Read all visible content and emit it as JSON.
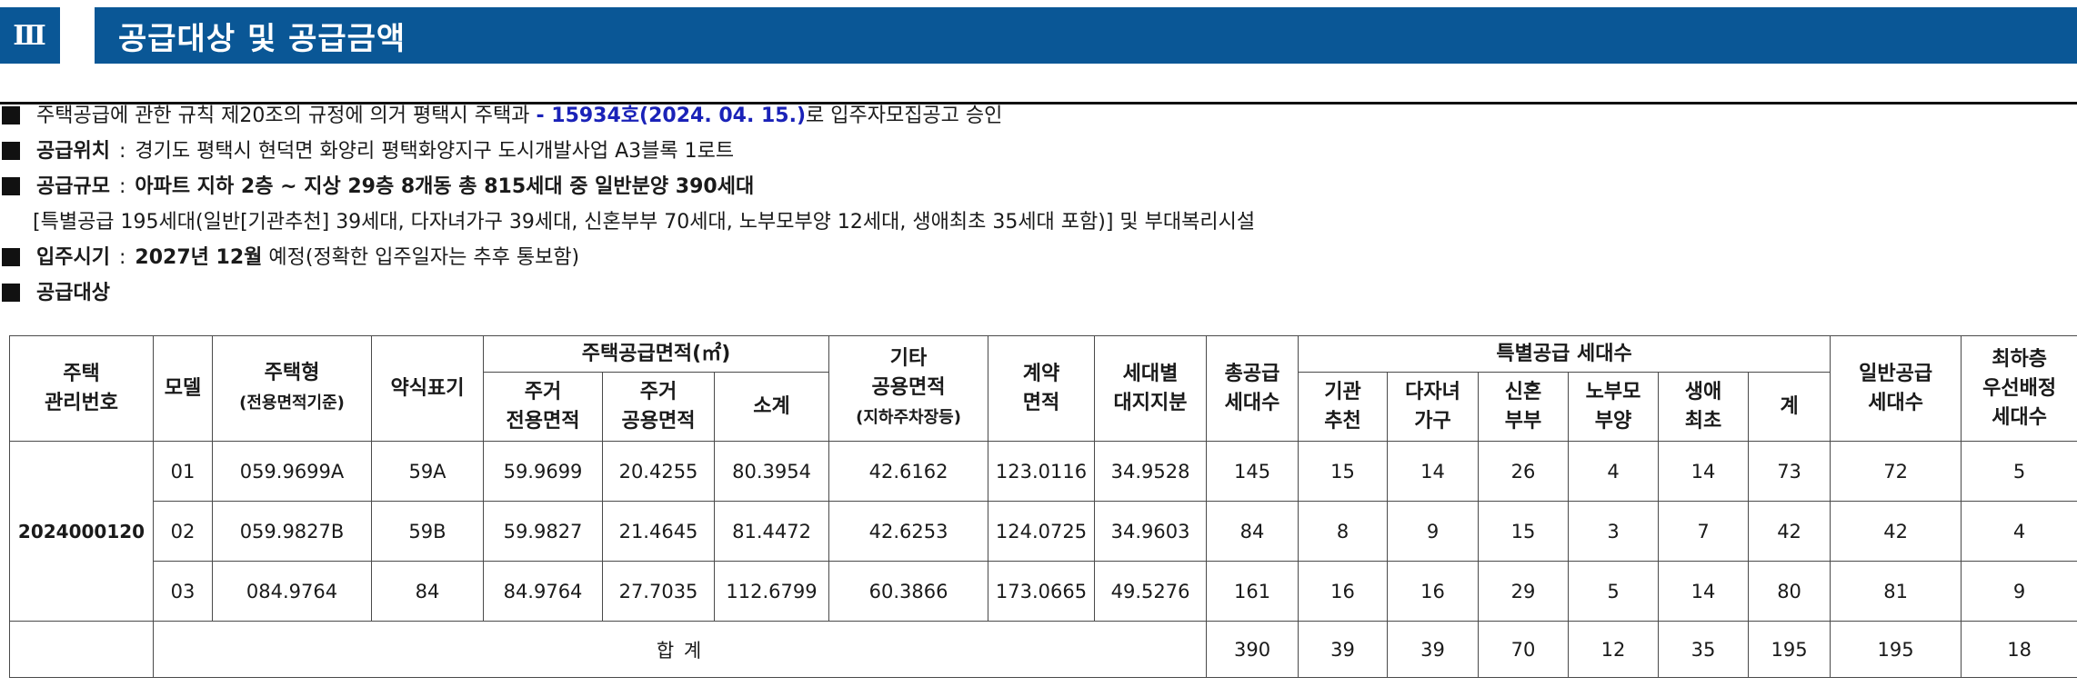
{
  "header": {
    "section_number": "Ⅲ",
    "title": "공급대상 및 공급금액"
  },
  "bullets": {
    "approval": {
      "text_a": "주택공급에 관한 규칙 제20조의 규정에 의거 평택시 주택과",
      "highlight": "- 15934호(2024. 04. 15.)",
      "text_b": "로 입주자모집공고 승인"
    },
    "location": {
      "label": "공급위치",
      "colon": ":",
      "value": "경기도 평택시 현덕면 화양리 평택화양지구 도시개발사업 A3블록 1로트"
    },
    "scale": {
      "label": "공급규모",
      "colon": ":",
      "value": "아파트 지하 2층 ~ 지상 29층 8개동 총 815세대 중 일반분양 390세대",
      "detail": "[특별공급 195세대(일반[기관추천] 39세대, 다자녀가구 39세대, 신혼부부 70세대, 노부모부양 12세대, 생애최초 35세대 포함)] 및 부대복리시설"
    },
    "move_in": {
      "label": "입주시기",
      "colon": ":",
      "value_bold": "2027년 12월",
      "value_rest": "예정(정확한 입주일자는 추후 통보함)"
    },
    "target": {
      "label": "공급대상"
    }
  },
  "table": {
    "headers": {
      "mgmt_no": [
        "주택",
        "관리번호"
      ],
      "model": "모델",
      "type": "주택형",
      "type_sub": "(전용면적기준)",
      "abbr": "약식표기",
      "area_group": "주택공급면적(㎡)",
      "exclusive": [
        "주거",
        "전용면적"
      ],
      "common": [
        "주거",
        "공용면적"
      ],
      "subtotal": "소계",
      "other": "기타",
      "other_sub1": "공용면적",
      "other_sub2": "(지하주차장등)",
      "contract": [
        "계약",
        "면적"
      ],
      "land": [
        "세대별",
        "대지지분"
      ],
      "total_households": [
        "총공급",
        "세대수"
      ],
      "special_group": "특별공급 세대수",
      "institution": [
        "기관",
        "추천"
      ],
      "multi_child": [
        "다자녀",
        "가구"
      ],
      "newlywed": [
        "신혼",
        "부부"
      ],
      "elderly": [
        "노부모",
        "부양"
      ],
      "first_time": [
        "생애",
        "최초"
      ],
      "special_sum": "계",
      "general": [
        "일반공급",
        "세대수"
      ],
      "lowest_floor": [
        "최하층",
        "우선배정",
        "세대수"
      ]
    },
    "management_number": "2024000120",
    "rows": [
      {
        "model": "01",
        "type": "059.9699A",
        "abbr": "59A",
        "exclusive": "59.9699",
        "common": "20.4255",
        "subtotal": "80.3954",
        "other": "42.6162",
        "contract": "123.0116",
        "land": "34.9528",
        "total": "145",
        "institution": "15",
        "multi_child": "14",
        "newlywed": "26",
        "elderly": "4",
        "first_time": "14",
        "special_sum": "73",
        "general": "72",
        "lowest_floor": "5"
      },
      {
        "model": "02",
        "type": "059.9827B",
        "abbr": "59B",
        "exclusive": "59.9827",
        "common": "21.4645",
        "subtotal": "81.4472",
        "other": "42.6253",
        "contract": "124.0725",
        "land": "34.9603",
        "total": "84",
        "institution": "8",
        "multi_child": "9",
        "newlywed": "15",
        "elderly": "3",
        "first_time": "7",
        "special_sum": "42",
        "general": "42",
        "lowest_floor": "4"
      },
      {
        "model": "03",
        "type": "084.9764",
        "abbr": "84",
        "exclusive": "84.9764",
        "common": "27.7035",
        "subtotal": "112.6799",
        "other": "60.3866",
        "contract": "173.0665",
        "land": "49.5276",
        "total": "161",
        "institution": "16",
        "multi_child": "16",
        "newlywed": "29",
        "elderly": "5",
        "first_time": "14",
        "special_sum": "80",
        "general": "81",
        "lowest_floor": "9"
      }
    ],
    "total_row": {
      "label": "합 계",
      "total": "390",
      "institution": "39",
      "multi_child": "39",
      "newlywed": "70",
      "elderly": "12",
      "first_time": "35",
      "special_sum": "195",
      "general": "195",
      "lowest_floor": "18"
    }
  },
  "colors": {
    "header_blue": "#0a5796",
    "highlight_blue": "#1a22b8"
  }
}
